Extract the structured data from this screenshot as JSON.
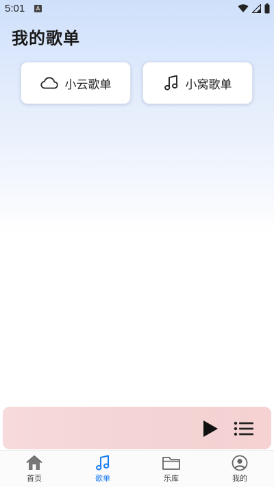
{
  "status_bar": {
    "time": "5:01",
    "notification_letter": "A"
  },
  "header": {
    "title": "我的歌单"
  },
  "playlists": [
    {
      "label": "小云歌单",
      "icon": "cloud-icon"
    },
    {
      "label": "小窝歌单",
      "icon": "music-note-icon"
    }
  ],
  "player": {
    "play_icon": "play-icon",
    "list_icon": "playlist-icon"
  },
  "tabs": [
    {
      "label": "首页",
      "icon": "home-icon",
      "active": false
    },
    {
      "label": "歌单",
      "icon": "music-note-icon",
      "active": true
    },
    {
      "label": "乐库",
      "icon": "folder-icon",
      "active": false
    },
    {
      "label": "我的",
      "icon": "user-icon",
      "active": false
    }
  ],
  "colors": {
    "accent": "#1a7cf5",
    "text": "#1a1a1a",
    "player_bg": "#f5d6d7"
  }
}
